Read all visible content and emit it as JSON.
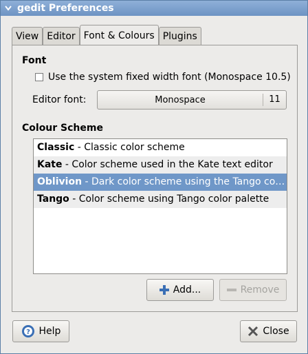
{
  "window": {
    "title": "gedit Preferences"
  },
  "tabs": [
    {
      "label": "View"
    },
    {
      "label": "Editor"
    },
    {
      "label": "Font & Colours"
    },
    {
      "label": "Plugins"
    }
  ],
  "font_section": {
    "heading": "Font",
    "system_font_checkbox_label": "Use the system fixed width font (Monospace 10.5)",
    "system_font_checked": false,
    "editor_font_label": "Editor font:",
    "editor_font_name": "Monospace",
    "editor_font_size": "11"
  },
  "colour_section": {
    "heading": "Colour Scheme",
    "schemes": [
      {
        "name": "Classic",
        "description": " - Classic color scheme"
      },
      {
        "name": "Kate",
        "description": " - Color scheme used in the Kate text editor"
      },
      {
        "name": "Oblivion",
        "description": " - Dark color scheme using the Tango co…"
      },
      {
        "name": "Tango",
        "description": " - Color scheme using Tango color palette"
      }
    ],
    "selected_index": 2,
    "add_label": "Add...",
    "remove_label": "Remove"
  },
  "footer": {
    "help_label": "Help",
    "close_label": "Close"
  },
  "colors": {
    "selection": "#6f97c8",
    "titlebar": "#7ea2cf"
  }
}
